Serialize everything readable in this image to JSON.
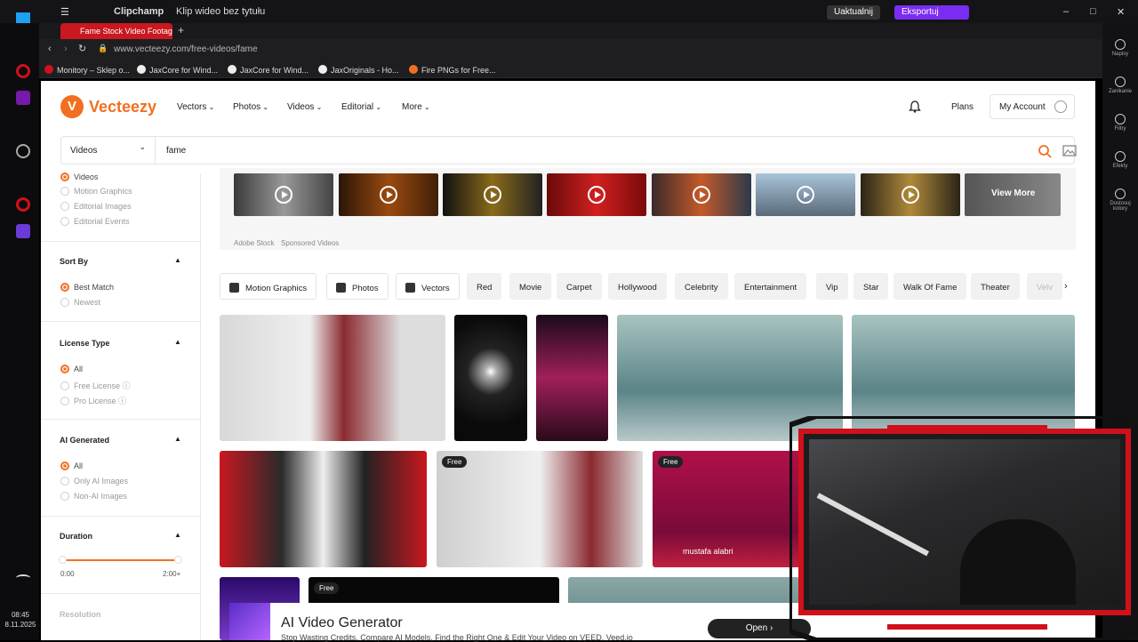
{
  "os": {
    "app_name": "Clipchamp",
    "doc_title": "Klip wideo bez tytułu",
    "update_label": "Uaktualnij",
    "export_label": "Eksportuj"
  },
  "taskbar": {
    "time": "08:45",
    "date": "8.11.2025"
  },
  "browser": {
    "tab_title": "Fame Stock Video Footage",
    "url": "www.vecteezy.com/free-videos/fame",
    "bookmarks": [
      "Monitory – Sklep o...",
      "JaxCore for Wind...",
      "JaxCore for Wind...",
      "JaxOriginals - Ho...",
      "Fire PNGs for Free..."
    ]
  },
  "rail": [
    "Napisy",
    "Zanikanie",
    "Filtry",
    "Efekty",
    "Dostosuj kolory"
  ],
  "header": {
    "logo_text": "Vecteezy",
    "nav": [
      "Vectors",
      "Photos",
      "Videos",
      "Editorial",
      "More"
    ],
    "plans": "Plans",
    "account": "My Account"
  },
  "search": {
    "type": "Videos",
    "query": "fame"
  },
  "sidebar": {
    "type_options": [
      "Videos",
      "Motion Graphics",
      "Editorial Images",
      "Editorial Events"
    ],
    "sort_title": "Sort By",
    "sort_options": [
      "Best Match",
      "Newest"
    ],
    "license_title": "License Type",
    "license_options": [
      "All",
      "Free License",
      "Pro License"
    ],
    "ai_title": "AI Generated",
    "ai_options": [
      "All",
      "Only AI Images",
      "Non-AI Images"
    ],
    "duration_title": "Duration",
    "duration_min": "0:00",
    "duration_max": "2:00+",
    "resolution_title": "Resolution"
  },
  "sponsored": {
    "view_more": "View More",
    "adobe": "Adobe Stock",
    "sponsored": "Sponsored Videos"
  },
  "chips": [
    "Motion Graphics",
    "Photos",
    "Vectors",
    "Red",
    "Movie",
    "Carpet",
    "Hollywood",
    "Celebrity",
    "Entertainment",
    "Vip",
    "Star",
    "Walk Of Fame",
    "Theater",
    "Velv"
  ],
  "results": {
    "free_badge": "Free",
    "author": "mustafa alabri"
  },
  "ad": {
    "title": "AI Video Generator",
    "subtitle": "Stop Wasting Credits. Compare AI Models, Find the Right One & Edit Your Video on VEED. Veed.io",
    "open": "Open"
  },
  "colors": {
    "brand": "#f26f21",
    "tab_red": "#c9181f",
    "export_purple": "#7b2cf2",
    "cam_frame": "#d0101a"
  }
}
